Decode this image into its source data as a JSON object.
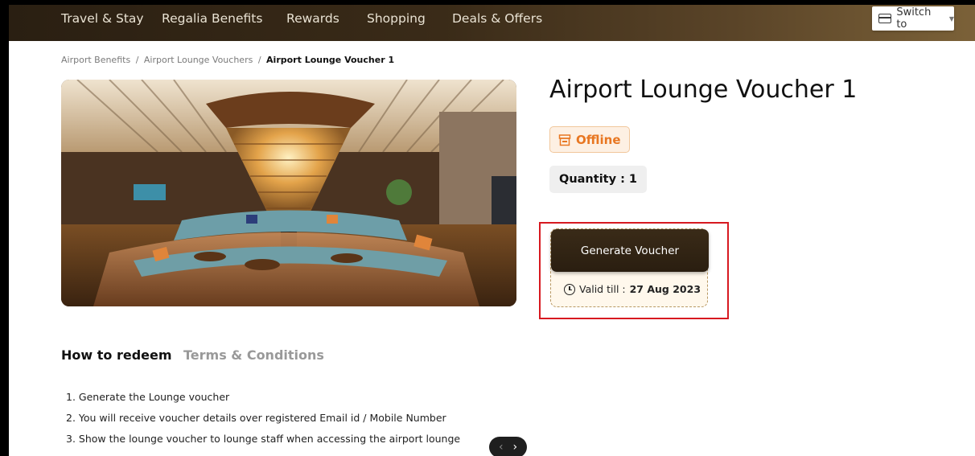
{
  "nav": {
    "items": [
      "Travel & Stay",
      "Regalia Benefits",
      "Rewards",
      "Shopping",
      "Deals & Offers"
    ],
    "switch_label": "Switch to"
  },
  "breadcrumb": {
    "items": [
      "Airport Benefits",
      "Airport Lounge Vouchers"
    ],
    "separator": "/",
    "current": "Airport Lounge Voucher 1"
  },
  "product": {
    "title": "Airport Lounge Voucher 1",
    "mode_badge": "Offline",
    "quantity": "Quantity : 1",
    "generate_label": "Generate Voucher",
    "valid_prefix": "Valid till :",
    "valid_date": "27 Aug 2023"
  },
  "tabs": [
    {
      "label": "How to redeem",
      "active": true
    },
    {
      "label": "Terms & Conditions",
      "active": false
    }
  ],
  "steps": [
    "1. Generate the Lounge voucher",
    "2. You will receive voucher details over registered Email id / Mobile Number",
    "3. Show the lounge voucher to lounge staff when accessing the airport lounge"
  ],
  "carousel": {
    "prev": "‹",
    "next": "›"
  },
  "colors": {
    "nav_bg": "#2a1f12",
    "accent_orange": "#e87722",
    "highlight_red": "#d71920",
    "button_dark": "#2a1e10"
  },
  "icons": [
    "card-icon",
    "caret-down-icon",
    "store-icon",
    "clock-icon",
    "chevron-left-icon",
    "chevron-right-icon"
  ]
}
